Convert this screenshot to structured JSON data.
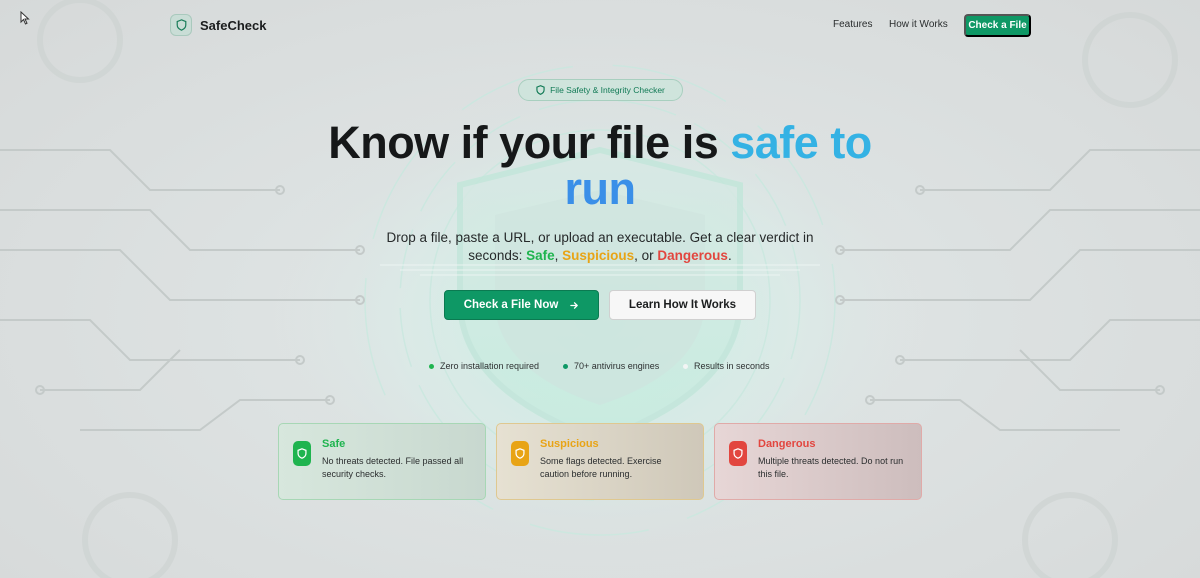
{
  "app": {
    "name": "SafeCheck",
    "logo_icon": "shield-icon"
  },
  "nav": {
    "links": [
      "Features",
      "How it Works"
    ],
    "cta_label": "Check a File"
  },
  "hero": {
    "badge": "File Safety & Integrity Checker",
    "headline_plain": "Know if your file is ",
    "headline_accent_1": "safe to",
    "headline_accent_2": "run",
    "subtitle_lead": "Drop a file, paste a URL, or upload an executable. Get a clear verdict in seconds: ",
    "verdict_safe": "Safe",
    "sep_1": ", ",
    "verdict_suspicious": "Suspicious",
    "sep_2": ", or ",
    "verdict_dangerous": "Dangerous",
    "subtitle_end": ".",
    "primary_button": "Check a File Now",
    "secondary_button": "Learn How It Works"
  },
  "features": [
    {
      "label": "Zero installation required",
      "dot_color": "#1fb44f"
    },
    {
      "label": "70+ antivirus engines",
      "dot_color": "#0e9865"
    },
    {
      "label": "Results in seconds",
      "dot_color": "#f2f5f4"
    }
  ],
  "verdicts": [
    {
      "title": "Safe",
      "description": "No threats detected. File passed all security checks.",
      "color": "#1fb44f",
      "icon": "shield-icon"
    },
    {
      "title": "Suspicious",
      "description": "Some flags detected. Exercise caution before running.",
      "color": "#e8a416",
      "icon": "shield-icon"
    },
    {
      "title": "Dangerous",
      "description": "Multiple threats detected. Do not run this file.",
      "color": "#e2463f",
      "icon": "shield-icon"
    }
  ],
  "colors": {
    "brand": "#0e9865",
    "accent_blue": "#34b2e4",
    "accent_blue_2": "#3a8fe8"
  }
}
